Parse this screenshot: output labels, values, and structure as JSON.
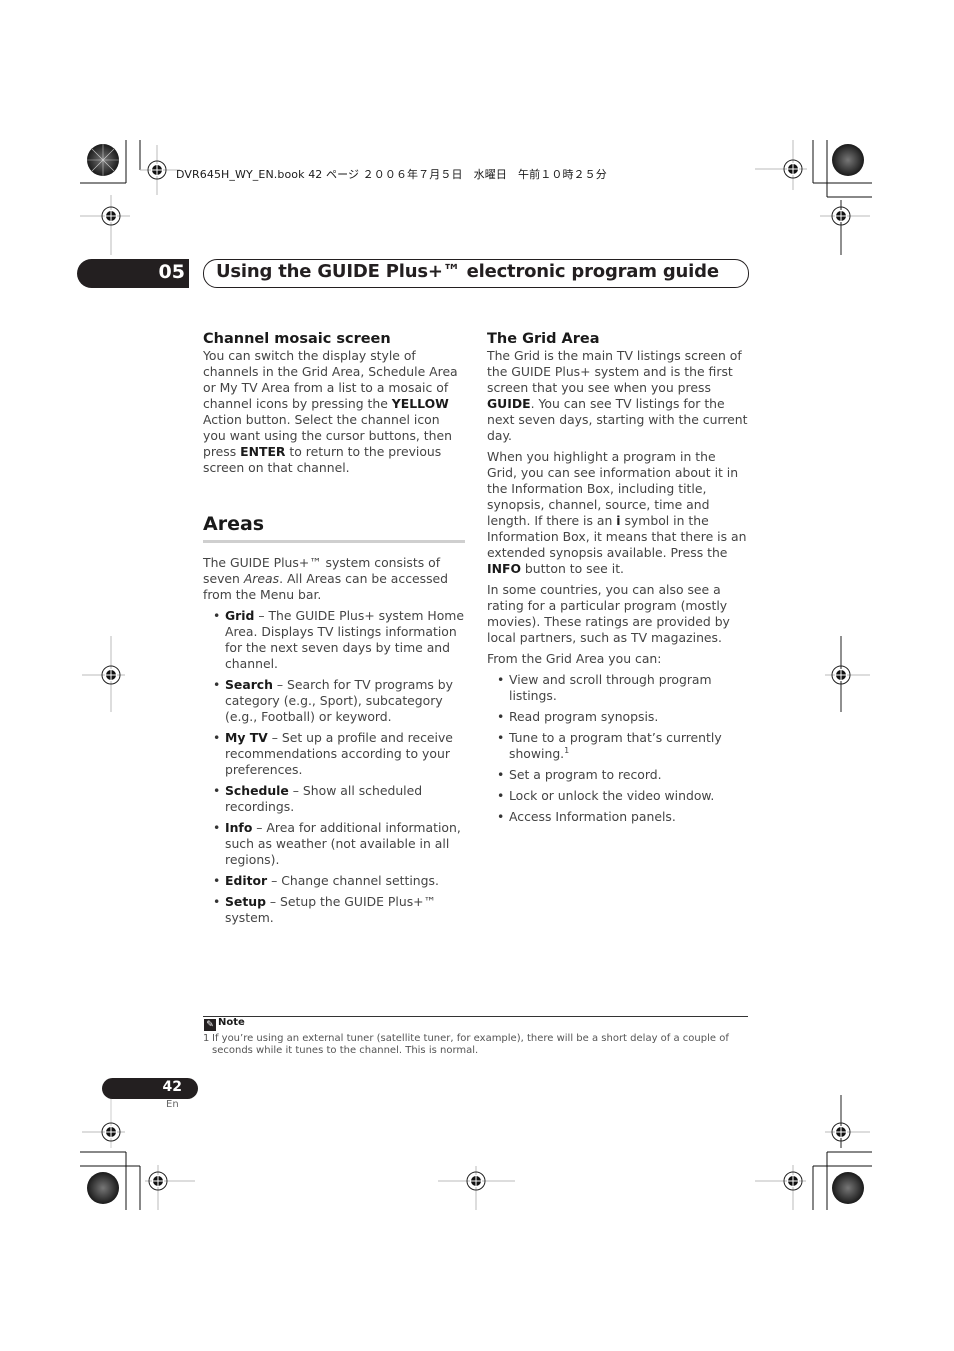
{
  "print_header": "DVR645H_WY_EN.book  42 ページ  ２００６年７月５日　水曜日　午前１０時２５分",
  "chapter": {
    "number": "05",
    "title": "Using the GUIDE Plus+™ electronic program guide"
  },
  "left_column": {
    "mosaic": {
      "heading": "Channel mosaic screen",
      "text_1": "You can switch the display style of channels in the Grid Area, Schedule Area or My TV Area from a list to a mosaic of channel icons by pressing the ",
      "bold_1": "YELLOW",
      "text_2": " Action button. Select the channel icon you want using the cursor buttons, then press ",
      "bold_2": "ENTER",
      "text_3": " to return to the previous screen on that channel."
    },
    "areas": {
      "heading": "Areas",
      "intro_1": "The GUIDE Plus+™ system consists of seven ",
      "intro_italic": "Areas",
      "intro_2": ". All Areas can be accessed from the Menu bar.",
      "items": [
        {
          "term": "Grid",
          "desc": " – The GUIDE Plus+ system Home Area. Displays TV listings information for the next seven days by time and channel."
        },
        {
          "term": "Search",
          "desc": " – Search for TV programs by category (e.g., Sport), subcategory (e.g., Football) or keyword."
        },
        {
          "term": "My TV",
          "desc": " – Set up a profile and receive recommendations according to your preferences."
        },
        {
          "term": "Schedule",
          "desc": " – Show all scheduled recordings."
        },
        {
          "term": "Info",
          "desc": " – Area for additional information, such as weather (not available in all regions)."
        },
        {
          "term": "Editor",
          "desc": " – Change channel settings."
        },
        {
          "term": "Setup",
          "desc": " – Setup the GUIDE Plus+™ system."
        }
      ]
    }
  },
  "right_column": {
    "heading": "The Grid Area",
    "p1_a": "The Grid is the main TV listings screen of the GUIDE Plus+ system and is the first screen that you see when you press ",
    "p1_bold": "GUIDE",
    "p1_b": ". You can see TV listings for the next seven days, starting with the current day.",
    "p2_a": "When you highlight a program in the Grid, you can see information about it in the Information Box, including title, synopsis, channel, source, time and length. If there is an ",
    "p2_bold_i": "i",
    "p2_b": " symbol in the Information Box, it means that there is an extended synopsis available. Press the ",
    "p2_bold_info": "INFO",
    "p2_c": " button to see it.",
    "p3": "In some countries, you can also see a rating for a particular program (mostly movies). These ratings are provided by local partners, such as TV magazines.",
    "p4": "From the Grid Area you can:",
    "bullets": [
      "View and scroll through program listings.",
      "Read program synopsis.",
      "Tune to a program that’s currently showing.",
      "Set a program to record.",
      "Lock or unlock the video window.",
      "Access Information panels."
    ],
    "footnote_ref": "1"
  },
  "note": {
    "heading": "Note",
    "number": "1",
    "text": "If you’re using an external tuner (satellite tuner, for example), there will be a short delay of a couple of seconds while it tunes to the channel. This is normal."
  },
  "page": {
    "number": "42",
    "language": "En"
  }
}
